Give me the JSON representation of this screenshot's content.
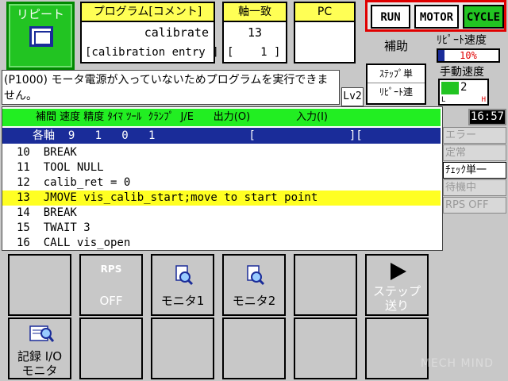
{
  "repeat_button": {
    "label": "リピート",
    "icon": "repeat-icon"
  },
  "program": {
    "header": "プログラム[コメント]",
    "name": "calibrate",
    "comment": "[calibration entry ]"
  },
  "axis_match": {
    "header": "軸一致",
    "value": "13",
    "step": "[    1 ]"
  },
  "pc": {
    "header": "PC"
  },
  "status": {
    "run": "RUN",
    "motor": "MOTOR",
    "cycle": "CYCLE",
    "cycle_color": "#22c422"
  },
  "aux_label": "補助",
  "repeat_speed": {
    "label": "ﾘﾋﾟｰﾄ速度",
    "value_text": "10%",
    "fraction": 0.1
  },
  "manual_speed": {
    "label": "手動速度",
    "value": "2",
    "low": "L",
    "high": "H"
  },
  "message": "(P1000) モータ電源が入っていないためプログラムを実行できません。",
  "level": "Lv2",
  "step_mode": {
    "line1": "ｽﾃｯﾌﾟ単",
    "line2": "ﾘﾋﾟｰﾄ連"
  },
  "clock": "16:57",
  "column_header": "補間 速度 精度 ﾀｲﾏ ﾂｰﾙ  ｸﾗﾝﾌﾟ  J/E      出力(O)              入力(I)",
  "axis_row": "各軸  9   1   0   1              [              ][                ]",
  "code_lines": [
    {
      "text": "10  BREAK",
      "highlight": false
    },
    {
      "text": "11  TOOL NULL",
      "highlight": false
    },
    {
      "text": "12  calib_ret = 0",
      "highlight": false
    },
    {
      "text": "13  JMOVE vis_calib_start;move to start point",
      "highlight": true
    },
    {
      "text": "14  BREAK",
      "highlight": false
    },
    {
      "text": "15  TWAIT 3",
      "highlight": false
    },
    {
      "text": "16  CALL vis_open",
      "highlight": false
    }
  ],
  "side_items": [
    {
      "label": "エラー",
      "active": false
    },
    {
      "label": "定常",
      "active": false
    },
    {
      "label": "ﾁｪｯｸ単一",
      "active": true
    },
    {
      "label": "待機中",
      "active": false
    },
    {
      "label": "RPS OFF",
      "active": false
    }
  ],
  "function_buttons": {
    "rps": {
      "top": "RPS",
      "bottom": "OFF"
    },
    "monitor1": "モニタ1",
    "monitor2": "モニタ2",
    "step_forward": {
      "line1": "ステップ",
      "line2": "送り"
    },
    "log_io": {
      "line1": "記録 I/O",
      "line2": "モニタ"
    }
  },
  "watermark": "MECH MIND"
}
